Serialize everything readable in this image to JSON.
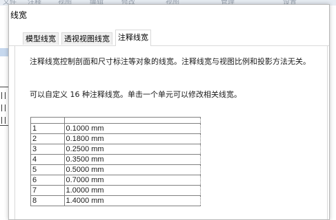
{
  "background": {
    "ghost_labels": [
      "文件",
      "注释",
      "视图",
      "编辑",
      "修改",
      "视图",
      "管理",
      "设置"
    ]
  },
  "dialog": {
    "title": "线宽",
    "tabs": [
      {
        "label": "模型线宽",
        "active": false
      },
      {
        "label": "透视视图线宽",
        "active": false
      },
      {
        "label": "注释线宽",
        "active": true
      }
    ],
    "description": "注释线宽控制剖面和尺寸标注等对象的线宽。注释线宽与视图比例和投影方法无关。",
    "instruction": "可以自定义 16 种注释线宽。单击一个单元可以修改相关线宽。",
    "rows": [
      {
        "num": "1",
        "value": "0.1000 mm"
      },
      {
        "num": "2",
        "value": "0.1800 mm"
      },
      {
        "num": "3",
        "value": "0.2500 mm"
      },
      {
        "num": "4",
        "value": "0.3500 mm"
      },
      {
        "num": "5",
        "value": "0.5000 mm"
      },
      {
        "num": "6",
        "value": "0.7000 mm"
      },
      {
        "num": "7",
        "value": "1.0000 mm"
      },
      {
        "num": "8",
        "value": "1.4000 mm"
      }
    ]
  }
}
